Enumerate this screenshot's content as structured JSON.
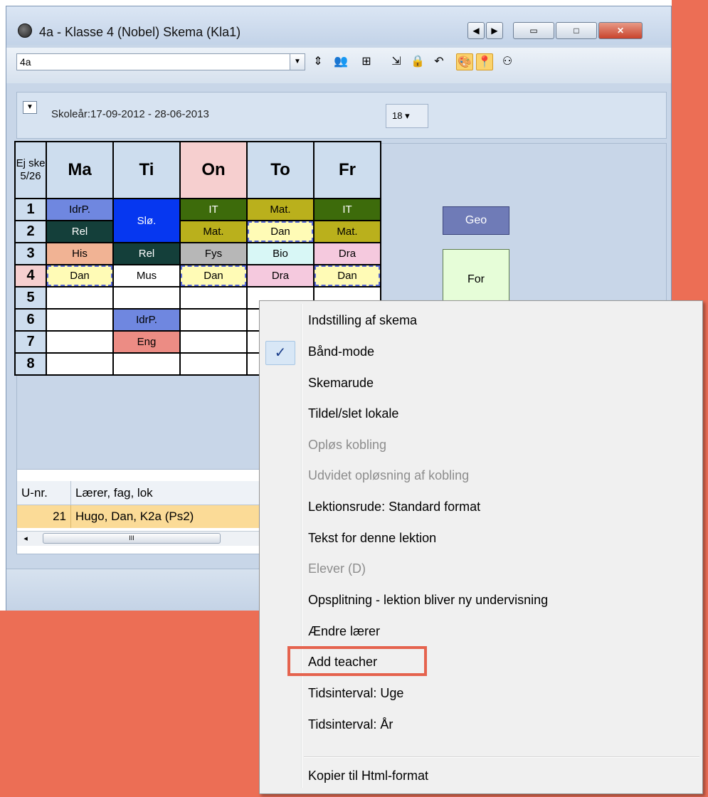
{
  "window": {
    "title": "4a - Klasse 4 (Nobel)  Skema  (Kla1)",
    "buttons": {
      "nav_left": "◀",
      "nav_right": "▶",
      "minimize": "▭",
      "maximize": "□",
      "close": "✕"
    }
  },
  "toolbar": {
    "class_value": "4a",
    "icons": [
      "spin-icon",
      "people-icon",
      "grid-icon",
      "export-icon",
      "lock-icon",
      "undo-icon",
      "palette-icon",
      "pin-icon",
      "users-icon"
    ]
  },
  "info": {
    "school_year": "Skoleår:17-09-2012 - 28-06-2013",
    "calendar_label": "18 ▾"
  },
  "schedule": {
    "corner": [
      "Ej ske",
      "5/26"
    ],
    "days": [
      "Ma",
      "Ti",
      "On",
      "To",
      "Fr"
    ],
    "periods": [
      "1",
      "2",
      "3",
      "4",
      "5",
      "6",
      "7",
      "8"
    ],
    "cells": {
      "ma1": "IdrP.",
      "ma2": "Rel",
      "ma3": "His",
      "ma4": "Dan",
      "ti12": "Slø.",
      "ti3": "Rel",
      "ti4": "Mus",
      "ti6": "IdrP.",
      "ti7": "Eng",
      "on1": "IT",
      "on2": "Mat.",
      "on3": "Fys",
      "on4": "Dan",
      "to1": "Mat.",
      "to2": "Dan",
      "to3": "Bio",
      "to4": "Dra",
      "fr1": "IT",
      "fr2": "Mat.",
      "fr3": "Dra",
      "fr4": "Dan"
    },
    "unscheduled": [
      "Geo",
      "For"
    ]
  },
  "lower_table": {
    "headers": [
      "U-nr.",
      "Lærer, fag, lok"
    ],
    "row": {
      "nr": "21",
      "text": "Hugo, Dan, K2a (Ps2)"
    },
    "scroll_thumb": "III"
  },
  "context_menu": {
    "check_mark": "✓",
    "items": [
      {
        "label": "Indstilling af skema",
        "enabled": true
      },
      {
        "label": "Bånd-mode",
        "enabled": true,
        "checked": true
      },
      {
        "label": "Skemarude",
        "enabled": true
      },
      {
        "label": "Tildel/slet lokale",
        "enabled": true
      },
      {
        "label": "Opløs kobling",
        "enabled": false
      },
      {
        "label": "Udvidet opløsning af kobling",
        "enabled": false
      },
      {
        "label": "Lektionsrude: Standard format",
        "enabled": true
      },
      {
        "label": "Tekst for denne lektion",
        "enabled": true
      },
      {
        "label": "Elever (D)",
        "enabled": false
      },
      {
        "label": "Opsplitning - lektion bliver ny undervisning",
        "enabled": true
      },
      {
        "label": "Ændre lærer",
        "enabled": true
      },
      {
        "label": "Add teacher",
        "enabled": true,
        "highlighted": true
      },
      {
        "label": "Tidsinterval: Uge",
        "enabled": true
      },
      {
        "label": "Tidsinterval: År",
        "enabled": true
      },
      {
        "label": "Kopier til Html-format",
        "enabled": true
      }
    ]
  },
  "colors": {
    "background_accent": "#ec6e55",
    "highlight_box": "#e5634e"
  }
}
